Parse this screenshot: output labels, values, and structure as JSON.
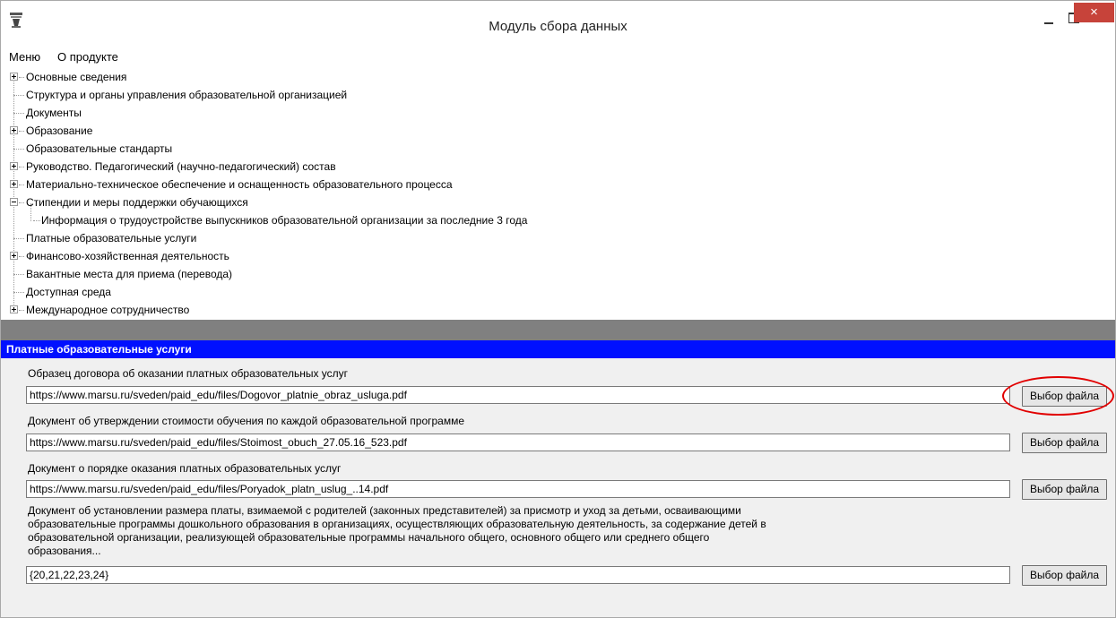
{
  "window": {
    "title": "Модуль сбора данных",
    "close_glyph": "×",
    "icons": [
      "app-icon",
      "minimize-icon",
      "maximize-icon",
      "close-icon"
    ]
  },
  "menu": {
    "items": [
      "Меню",
      "О продукте"
    ]
  },
  "tree": {
    "items": [
      {
        "label": "Основные сведения",
        "expander": "+"
      },
      {
        "label": "Структура и органы управления образовательной организацией",
        "expander": ""
      },
      {
        "label": "Документы",
        "expander": ""
      },
      {
        "label": "Образование",
        "expander": "+"
      },
      {
        "label": "Образовательные стандарты",
        "expander": ""
      },
      {
        "label": "Руководство. Педагогический (научно-педагогический) состав",
        "expander": "+"
      },
      {
        "label": "Материально-техническое обеспечение и оснащенность образовательного процесса",
        "expander": "+"
      },
      {
        "label": "Стипендии и меры поддержки обучающихся",
        "expander": "-"
      },
      {
        "label": "Информация о трудоустройстве выпускников образовательной организации за последние 3 года",
        "expander": "",
        "child": true
      },
      {
        "label": "Платные образовательные услуги",
        "expander": ""
      },
      {
        "label": "Финансово-хозяйственная деятельность",
        "expander": "+"
      },
      {
        "label": "Вакантные места для приема (перевода)",
        "expander": ""
      },
      {
        "label": "Доступная среда",
        "expander": ""
      },
      {
        "label": "Международное сотрудничество",
        "expander": "+"
      }
    ]
  },
  "section": {
    "title": "Платные образовательные услуги",
    "header_color": "#0010ff"
  },
  "fields": [
    {
      "label": "Образец договора об оказании платных образовательных услуг",
      "value": "https://www.marsu.ru/sveden/paid_edu/files/Dogovor_platnie_obraz_usluga.pdf",
      "button": "Выбор файла"
    },
    {
      "label": "Документ об утверждении стоимости обучения по каждой образовательной программе",
      "value": "https://www.marsu.ru/sveden/paid_edu/files/Stoimost_obuch_27.05.16_523.pdf",
      "button": "Выбор файла"
    },
    {
      "label": "Документ о порядке оказания платных образовательных услуг",
      "value": "https://www.marsu.ru/sveden/paid_edu/files/Poryadok_platn_uslug_..14.pdf",
      "button": "Выбор файла"
    },
    {
      "label": "Документ об установлении размера платы, взимаемой с родителей (законных представителей) за присмотр и уход за детьми, осваивающими образовательные программы дошкольного образования в организациях, осуществляющих образовательную деятельность, за содержание детей в образовательной организации, реализующей образовательные программы начального общего, основного общего или среднего общего образования...",
      "value": "{20,21,22,23,24}",
      "button": "Выбор файла"
    }
  ],
  "highlight_color": "#e10000"
}
